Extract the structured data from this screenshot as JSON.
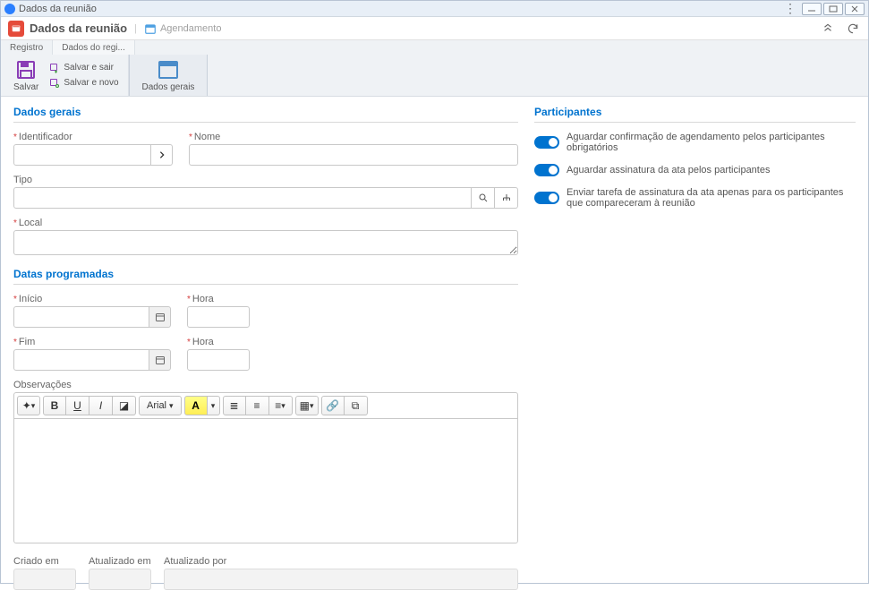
{
  "titlebar": {
    "title": "Dados da reunião"
  },
  "header": {
    "title": "Dados da reunião",
    "schedule_link": "Agendamento"
  },
  "ribbon": {
    "tab_registro": "Registro",
    "tab_dados": "Dados do regi...",
    "salvar": "Salvar",
    "salvar_sair": "Salvar e sair",
    "salvar_novo": "Salvar e novo",
    "dados_gerais": "Dados gerais"
  },
  "sections": {
    "dados_gerais": "Dados gerais",
    "datas": "Datas programadas",
    "participantes": "Participantes"
  },
  "fields": {
    "identificador": "Identificador",
    "nome": "Nome",
    "tipo": "Tipo",
    "local": "Local",
    "inicio": "Início",
    "hora": "Hora",
    "fim": "Fim",
    "observacoes": "Observações",
    "criado_em": "Criado em",
    "atualizado_em": "Atualizado em",
    "atualizado_por": "Atualizado por"
  },
  "toggles": {
    "t1": "Aguardar confirmação de agendamento pelos participantes obrigatórios",
    "t2": "Aguardar assinatura da ata pelos participantes",
    "t3": "Enviar tarefa de assinatura da ata apenas para os participantes que compareceram à reunião"
  },
  "rte": {
    "font": "Arial"
  }
}
